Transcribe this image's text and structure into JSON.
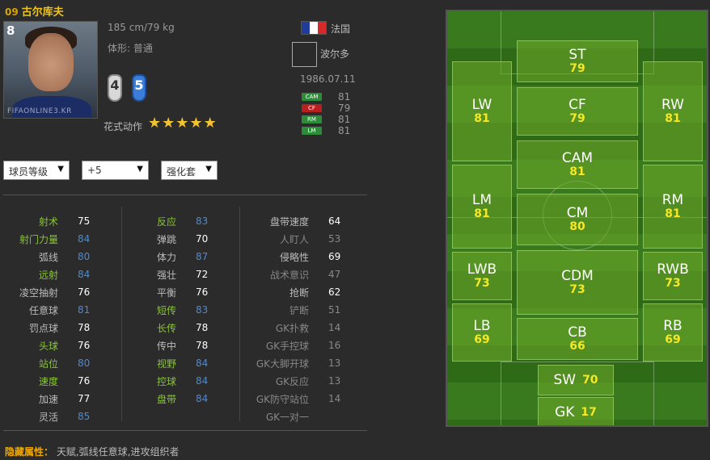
{
  "player": {
    "season": "09",
    "name": "古尔库夫",
    "jersey_number": "8",
    "height_weight": "185 cm/79 kg",
    "body_type": "体形: 普通",
    "left_foot": "4",
    "right_foot": "5",
    "trick_label": "花式动作",
    "trick_stars": 5,
    "nation": "法国",
    "club": "波尔多",
    "birth_date": "1986.07.11",
    "photo_watermark": "FIFAONLINE3.KR"
  },
  "positions": [
    {
      "tag": "CAM",
      "value": "81",
      "color": "#2e8b3a"
    },
    {
      "tag": "CF",
      "value": "79",
      "color": "#b81f1f"
    },
    {
      "tag": "RM",
      "value": "81",
      "color": "#2e8b3a"
    },
    {
      "tag": "LM",
      "value": "81",
      "color": "#2e8b3a"
    }
  ],
  "controls": {
    "grade_select": "球员等级",
    "plus_select": "+5",
    "boost_select": "强化套"
  },
  "colors": {
    "highlight_label": "#8bc43a",
    "normal_label": "#bbbbbb",
    "dim_label": "#888888",
    "white_value": "#ffffff",
    "blue_value": "#4a8ad8",
    "dim_value": "#888888"
  },
  "attributes": {
    "col1": [
      {
        "label": "射术",
        "value": "75",
        "lc": "highlight_label",
        "vc": "white_value"
      },
      {
        "label": "射门力量",
        "value": "84",
        "lc": "highlight_label",
        "vc": "blue_value"
      },
      {
        "label": "弧线",
        "value": "80",
        "lc": "normal_label",
        "vc": "blue_value"
      },
      {
        "label": "远射",
        "value": "84",
        "lc": "highlight_label",
        "vc": "blue_value"
      },
      {
        "label": "凌空抽射",
        "value": "76",
        "lc": "normal_label",
        "vc": "white_value"
      },
      {
        "label": "任意球",
        "value": "81",
        "lc": "normal_label",
        "vc": "blue_value"
      },
      {
        "label": "罚点球",
        "value": "78",
        "lc": "normal_label",
        "vc": "white_value"
      },
      {
        "label": "头球",
        "value": "76",
        "lc": "highlight_label",
        "vc": "white_value"
      },
      {
        "label": "站位",
        "value": "80",
        "lc": "highlight_label",
        "vc": "blue_value"
      },
      {
        "label": "速度",
        "value": "76",
        "lc": "highlight_label",
        "vc": "white_value"
      },
      {
        "label": "加速",
        "value": "77",
        "lc": "normal_label",
        "vc": "white_value"
      },
      {
        "label": "灵活",
        "value": "85",
        "lc": "normal_label",
        "vc": "blue_value"
      }
    ],
    "col2": [
      {
        "label": "反应",
        "value": "83",
        "lc": "highlight_label",
        "vc": "blue_value"
      },
      {
        "label": "弹跳",
        "value": "70",
        "lc": "normal_label",
        "vc": "white_value"
      },
      {
        "label": "体力",
        "value": "87",
        "lc": "normal_label",
        "vc": "blue_value"
      },
      {
        "label": "强壮",
        "value": "72",
        "lc": "normal_label",
        "vc": "white_value"
      },
      {
        "label": "平衡",
        "value": "76",
        "lc": "normal_label",
        "vc": "white_value"
      },
      {
        "label": "短传",
        "value": "83",
        "lc": "highlight_label",
        "vc": "blue_value"
      },
      {
        "label": "长传",
        "value": "78",
        "lc": "highlight_label",
        "vc": "white_value"
      },
      {
        "label": "传中",
        "value": "78",
        "lc": "normal_label",
        "vc": "white_value"
      },
      {
        "label": "视野",
        "value": "84",
        "lc": "highlight_label",
        "vc": "blue_value"
      },
      {
        "label": "控球",
        "value": "84",
        "lc": "highlight_label",
        "vc": "blue_value"
      },
      {
        "label": "盘带",
        "value": "84",
        "lc": "highlight_label",
        "vc": "blue_value"
      }
    ],
    "col3": [
      {
        "label": "盘带速度",
        "value": "64",
        "lc": "normal_label",
        "vc": "white_value"
      },
      {
        "label": "人盯人",
        "value": "53",
        "lc": "dim_label",
        "vc": "dim_value"
      },
      {
        "label": "侵略性",
        "value": "69",
        "lc": "normal_label",
        "vc": "white_value"
      },
      {
        "label": "战术意识",
        "value": "47",
        "lc": "dim_label",
        "vc": "dim_value"
      },
      {
        "label": "抢断",
        "value": "62",
        "lc": "normal_label",
        "vc": "white_value"
      },
      {
        "label": "铲断",
        "value": "51",
        "lc": "dim_label",
        "vc": "dim_value"
      },
      {
        "label": "GK扑救",
        "value": "14",
        "lc": "dim_label",
        "vc": "dim_value"
      },
      {
        "label": "GK手控球",
        "value": "16",
        "lc": "dim_label",
        "vc": "dim_value"
      },
      {
        "label": "GK大脚开球",
        "value": "13",
        "lc": "dim_label",
        "vc": "dim_value"
      },
      {
        "label": "GK反应",
        "value": "13",
        "lc": "dim_label",
        "vc": "dim_value"
      },
      {
        "label": "GK防守站位",
        "value": "14",
        "lc": "dim_label",
        "vc": "dim_value"
      },
      {
        "label": "GK一对一",
        "value": "",
        "lc": "dim_label",
        "vc": "dim_value"
      }
    ]
  },
  "hidden_traits": {
    "label": "隐藏属性：",
    "text": "天赋,弧线任意球,进攻组织者"
  },
  "pitch": {
    "ST": "79",
    "LW": "81",
    "CF": "79",
    "RW": "81",
    "CAM": "81",
    "LM": "81",
    "CM": "80",
    "RM": "81",
    "LWB": "73",
    "CDM": "73",
    "RWB": "73",
    "LB": "69",
    "CB": "66",
    "RB": "69",
    "SW": "70",
    "GK": "17"
  },
  "pitch_names": {
    "ST": "ST",
    "LW": "LW",
    "CF": "CF",
    "RW": "RW",
    "CAM": "CAM",
    "LM": "LM",
    "CM": "CM",
    "RM": "RM",
    "LWB": "LWB",
    "CDM": "CDM",
    "RWB": "RWB",
    "LB": "LB",
    "CB": "CB",
    "RB": "RB",
    "SW": "SW",
    "GK": "GK"
  }
}
